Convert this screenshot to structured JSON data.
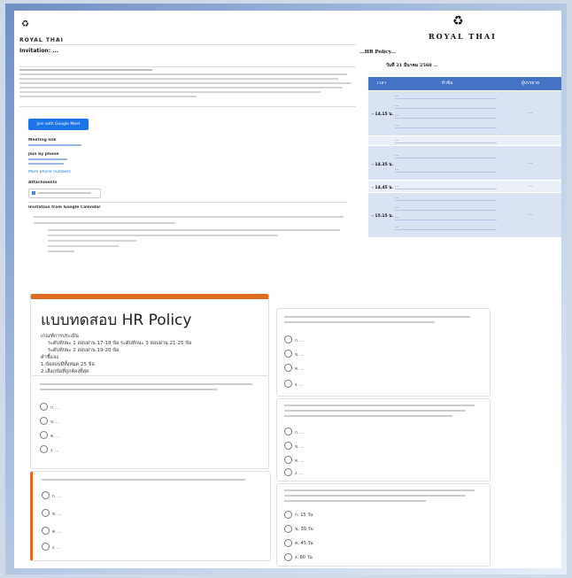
{
  "email": {
    "logo_text": "ROYAL THAI",
    "subject": "Invitation: ...",
    "join_button": "Join with Google Meet",
    "meeting_link_label": "Meeting link",
    "join_phone_label": "Join by phone",
    "more_numbers": "More phone numbers",
    "attachments_label": "Attachments",
    "invitation_from": "Invitation from Google Calendar"
  },
  "agenda": {
    "logo_text": "ROYAL THAI",
    "title": "...HR Policy...",
    "subtitle": "วันที่ 21 มีนาคม 2568 ...",
    "columns": [
      "เวลา",
      "หัวข้อ",
      "ผู้บรรยาย"
    ],
    "rows": [
      {
        "time": "- 14.15 น.",
        "items": [
          "...",
          "...",
          "...",
          "..."
        ],
        "person": "..."
      },
      {
        "time": "",
        "items": [
          "..."
        ],
        "person": ""
      },
      {
        "time": "- 14.35 น.",
        "items": [
          "...",
          "..."
        ],
        "person": "..."
      },
      {
        "time": "- 14.45 น.",
        "items": [
          "..."
        ],
        "person": "..."
      },
      {
        "time": "- 15.15 น.",
        "items": [
          "...",
          "...",
          "...",
          "..."
        ],
        "person": "..."
      }
    ]
  },
  "quiz": {
    "title": "แบบทดสอบ   HR Policy",
    "intro_lines": [
      "เกณฑ์การประเมิน",
      "ระดับทักษะ 1 สอบผ่าน 17-18 ข้อ    ระดับทักษะ 3 สอบผ่าน 21-25 ข้อ",
      "ระดับทักษะ 2 สอบผ่าน 19-20 ข้อ",
      "คำชี้แจง",
      "1.ข้อสอบมีทั้งหมด 25 ข้อ",
      "2.เลือกข้อที่ถูกต้องที่สุด"
    ],
    "q1": {
      "options": [
        "ก. ...",
        "ข. ...",
        "ค. ...",
        "ง. ..."
      ]
    },
    "q2": {
      "options": [
        "ก. ...",
        "ข. ...",
        "ค. ...",
        "ง. ..."
      ]
    },
    "q3": {
      "options": [
        "ก. ...",
        "ข. ...",
        "ค. ...",
        "ง. ..."
      ]
    },
    "q4": {
      "options": [
        "ก. ...",
        "ข. ...",
        "ค. ...",
        "ง. ..."
      ]
    },
    "q5": {
      "options": [
        "ก. 15 วัน",
        "ข. 30 วัน",
        "ค. 45 วัน",
        "ง. 60 วัน"
      ]
    }
  },
  "colors": {
    "accent": "#e06c1f",
    "table_header": "#4472c4",
    "table_row": "#dae3f3",
    "meet_button": "#1a73e8"
  }
}
